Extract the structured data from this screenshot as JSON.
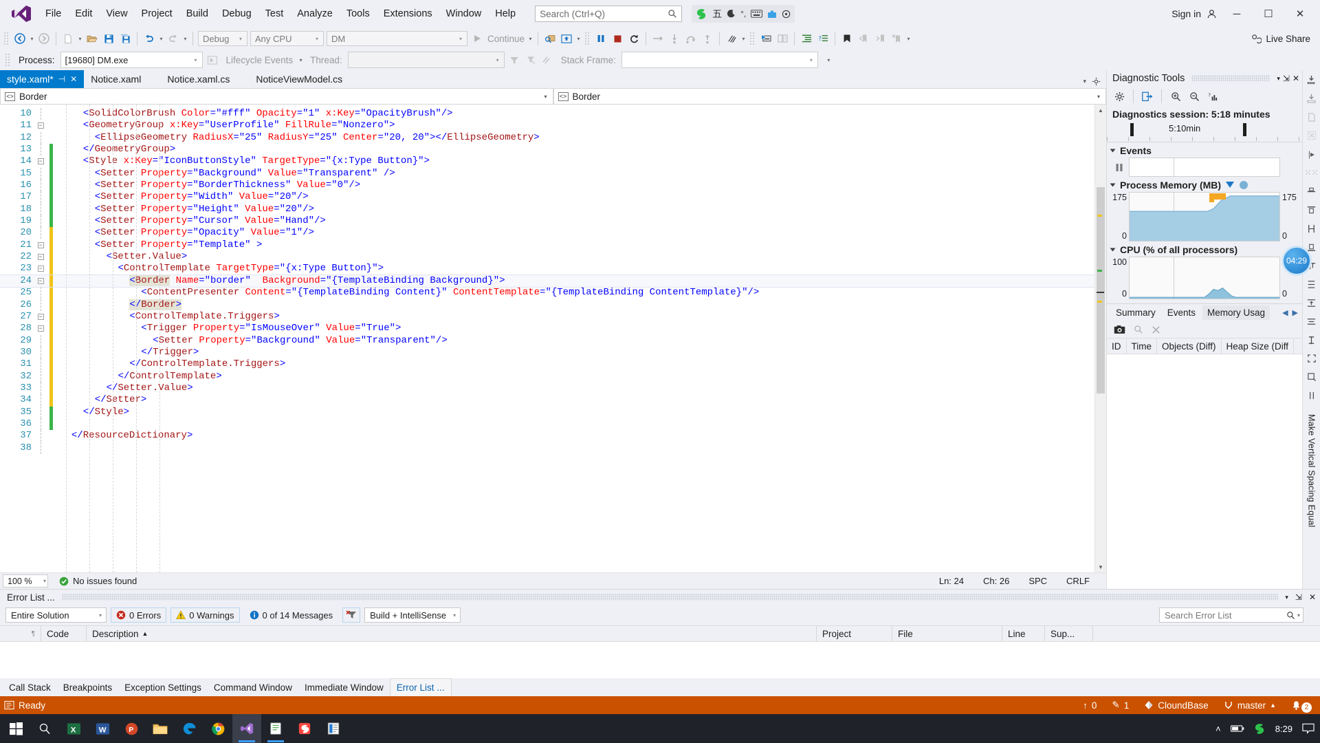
{
  "app": {
    "menu": [
      "File",
      "Edit",
      "View",
      "Project",
      "Build",
      "Debug",
      "Test",
      "Analyze",
      "Tools",
      "Extensions",
      "Window",
      "Help"
    ],
    "search_placeholder": "Search (Ctrl+Q)",
    "sign_in": "Sign in",
    "live_share": "Live Share",
    "window_buttons": {
      "minimize": "─",
      "maximize": "☐",
      "close": "✕"
    }
  },
  "toolbar": {
    "config_combo": "Debug",
    "platform_combo": "Any CPU",
    "startup_combo": "DM",
    "continue_label": "Continue",
    "icons": [
      "navigate-back-icon",
      "navigate-forward-icon",
      "new-item-icon",
      "open-file-icon",
      "save-icon",
      "save-all-icon",
      "undo-icon",
      "redo-icon",
      "start-debug-icon",
      "attach-icon",
      "hot-reload-icon",
      "pause-icon",
      "stop-icon",
      "restart-icon",
      "show-next-statement-icon",
      "step-into-icon",
      "step-over-icon",
      "step-out-icon",
      "intellitrace-icon",
      "select-control-icon",
      "compare-icon",
      "indent-icon",
      "code-map-icon",
      "bookmark-icon",
      "prev-bookmark-icon",
      "next-bookmark-icon",
      "clear-bookmarks-icon"
    ]
  },
  "debugbar": {
    "process_label": "Process:",
    "process_value": "[19680] DM.exe",
    "lifecycle_label": "Lifecycle Events",
    "thread_label": "Thread:",
    "thread_value": "",
    "stackframe_label": "Stack Frame:",
    "stackframe_value": ""
  },
  "tabs": [
    {
      "label": "style.xaml*",
      "active": true,
      "pinned": true,
      "closable": true
    },
    {
      "label": "Notice.xaml",
      "active": false
    },
    {
      "label": "Notice.xaml.cs",
      "active": false
    },
    {
      "label": "NoticeViewModel.cs",
      "active": false
    }
  ],
  "navbars": {
    "left": "Border",
    "right": "Border"
  },
  "editor": {
    "zoom": "100 %",
    "issues": "No issues found",
    "line_indicator": "Ln: 24",
    "char_indicator": "Ch: 26",
    "spaces": "SPC",
    "eol": "CRLF",
    "first_line": 10,
    "lines": [
      {
        "n": 10,
        "indent": 4,
        "fold": "",
        "bar": "none",
        "text": "<SolidColorBrush Color=\"#fff\" Opacity=\"1\" x:Key=\"OpacityBrush\"/>"
      },
      {
        "n": 11,
        "indent": 4,
        "fold": "-",
        "bar": "none",
        "text": "<GeometryGroup x:Key=\"UserProfile\" FillRule=\"Nonzero\">"
      },
      {
        "n": 12,
        "indent": 6,
        "fold": "",
        "bar": "none",
        "text": "<EllipseGeometry RadiusX=\"25\" RadiusY=\"25\" Center=\"20, 20\"></EllipseGeometry>"
      },
      {
        "n": 13,
        "indent": 4,
        "fold": "",
        "bar": "green",
        "text": "</GeometryGroup>"
      },
      {
        "n": 14,
        "indent": 4,
        "fold": "-",
        "bar": "green",
        "text": "<Style x:Key=\"IconButtonStyle\" TargetType=\"{x:Type Button}\">"
      },
      {
        "n": 15,
        "indent": 6,
        "fold": "",
        "bar": "green",
        "text": "<Setter Property=\"Background\" Value=\"Transparent\" />"
      },
      {
        "n": 16,
        "indent": 6,
        "fold": "",
        "bar": "green",
        "text": "<Setter Property=\"BorderThickness\" Value=\"0\"/>"
      },
      {
        "n": 17,
        "indent": 6,
        "fold": "",
        "bar": "green",
        "text": "<Setter Property=\"Width\" Value=\"20\"/>"
      },
      {
        "n": 18,
        "indent": 6,
        "fold": "",
        "bar": "green",
        "text": "<Setter Property=\"Height\" Value=\"20\"/>"
      },
      {
        "n": 19,
        "indent": 6,
        "fold": "",
        "bar": "green",
        "text": "<Setter Property=\"Cursor\" Value=\"Hand\"/>"
      },
      {
        "n": 20,
        "indent": 6,
        "fold": "",
        "bar": "yellow",
        "text": "<Setter Property=\"Opacity\" Value=\"1\"/>"
      },
      {
        "n": 21,
        "indent": 6,
        "fold": "-",
        "bar": "yellow",
        "text": "<Setter Property=\"Template\" >"
      },
      {
        "n": 22,
        "indent": 8,
        "fold": "-",
        "bar": "yellow",
        "text": "<Setter.Value>"
      },
      {
        "n": 23,
        "indent": 10,
        "fold": "-",
        "bar": "yellow",
        "text": "<ControlTemplate TargetType=\"{x:Type Button}\">"
      },
      {
        "n": 24,
        "indent": 12,
        "fold": "-",
        "bar": "yellow",
        "text": "<Border Name=\"border\"  Background=\"{TemplateBinding Background}\">",
        "current": true
      },
      {
        "n": 25,
        "indent": 14,
        "fold": "",
        "bar": "yellow",
        "text": "<ContentPresenter Content=\"{TemplateBinding Content}\" ContentTemplate=\"{TemplateBinding ContentTemplate}\"/>"
      },
      {
        "n": 26,
        "indent": 12,
        "fold": "",
        "bar": "yellow",
        "text": "</Border>",
        "matchtag": true
      },
      {
        "n": 27,
        "indent": 12,
        "fold": "-",
        "bar": "yellow",
        "text": "<ControlTemplate.Triggers>"
      },
      {
        "n": 28,
        "indent": 14,
        "fold": "-",
        "bar": "yellow",
        "text": "<Trigger Property=\"IsMouseOver\" Value=\"True\">"
      },
      {
        "n": 29,
        "indent": 16,
        "fold": "",
        "bar": "yellow",
        "text": "<Setter Property=\"Background\" Value=\"Transparent\"/>"
      },
      {
        "n": 30,
        "indent": 14,
        "fold": "",
        "bar": "yellow",
        "text": "</Trigger>"
      },
      {
        "n": 31,
        "indent": 12,
        "fold": "",
        "bar": "yellow",
        "text": "</ControlTemplate.Triggers>"
      },
      {
        "n": 32,
        "indent": 10,
        "fold": "",
        "bar": "yellow",
        "text": "</ControlTemplate>"
      },
      {
        "n": 33,
        "indent": 8,
        "fold": "",
        "bar": "yellow",
        "text": "</Setter.Value>"
      },
      {
        "n": 34,
        "indent": 6,
        "fold": "",
        "bar": "yellow",
        "text": "</Setter>"
      },
      {
        "n": 35,
        "indent": 4,
        "fold": "",
        "bar": "green",
        "text": "</Style>"
      },
      {
        "n": 36,
        "indent": 0,
        "fold": "",
        "bar": "green",
        "text": ""
      },
      {
        "n": 37,
        "indent": 2,
        "fold": "",
        "bar": "none",
        "text": "</ResourceDictionary>"
      },
      {
        "n": 38,
        "indent": 0,
        "fold": "",
        "bar": "none",
        "text": ""
      }
    ]
  },
  "diagnostics": {
    "title": "Diagnostic Tools",
    "toolbar_icons": [
      "settings-gear-icon",
      "export-icon",
      "zoom-in-icon",
      "zoom-out-icon",
      "reset-view-icon"
    ],
    "session": "Diagnostics session: 5:18 minutes",
    "ruler_label": "5:10min",
    "sections": {
      "events": "Events",
      "memory": "Process Memory (MB)",
      "cpu": "CPU (% of all processors)"
    },
    "memory_axis": {
      "max_left": "175",
      "max_right": "175",
      "min_left": "0",
      "min_right": "0"
    },
    "cpu_axis": {
      "max_left": "100",
      "max_right": "100",
      "min_left": "0",
      "min_right": "0"
    },
    "tabs": [
      "Summary",
      "Events",
      "Memory Usag"
    ],
    "active_tab": "Memory Usag",
    "tooltip_time": "04:29",
    "columns": [
      "ID",
      "Time",
      "Objects (Diff)",
      "Heap Size (Diff"
    ],
    "tool_icons": [
      "camera-icon",
      "search-icon",
      "clear-icon"
    ]
  },
  "chart_data": [
    {
      "type": "area",
      "title": "Process Memory (MB)",
      "xlabel": "",
      "ylabel": "MB",
      "ylim": [
        0,
        175
      ],
      "grid": false,
      "x": [
        0,
        10,
        20,
        30,
        40,
        50,
        55,
        60,
        65,
        70,
        75,
        80,
        85,
        90,
        95,
        100
      ],
      "values": [
        108,
        108,
        108,
        108,
        108,
        108,
        110,
        118,
        140,
        160,
        162,
        162,
        162,
        162,
        162,
        162
      ],
      "annotation": "orange memory-allocation marker near x=70"
    },
    {
      "type": "area",
      "title": "CPU (% of all processors)",
      "xlabel": "",
      "ylabel": "%",
      "ylim": [
        0,
        100
      ],
      "grid": false,
      "x": [
        0,
        10,
        20,
        30,
        40,
        50,
        55,
        60,
        65,
        70,
        75,
        80,
        85,
        90,
        95,
        100
      ],
      "values": [
        0,
        0,
        0,
        0,
        0,
        0,
        2,
        10,
        13,
        11,
        14,
        12,
        5,
        1,
        0,
        0
      ]
    }
  ],
  "errorlist": {
    "title": "Error List ...",
    "scope": "Entire Solution",
    "errors": "0 Errors",
    "warnings": "0 Warnings",
    "messages": "0 of 14 Messages",
    "filter_icon": "clear-filter-icon",
    "build_filter": "Build + IntelliSense",
    "search_placeholder": "Search Error List",
    "columns": [
      "",
      "Code",
      "Description",
      "Project",
      "File",
      "Line",
      "Sup..."
    ],
    "sort_column": "Description",
    "rows": []
  },
  "dock_tabs": {
    "items": [
      "Call Stack",
      "Breakpoints",
      "Exception Settings",
      "Command Window",
      "Immediate Window",
      "Error List ..."
    ],
    "active": "Error List ..."
  },
  "statusbar": {
    "state": "Ready",
    "outgoing": "0",
    "changes": "1",
    "repo": "CloundBase",
    "branch": "master",
    "notifications": "2"
  },
  "taskbar": {
    "apps": [
      "start-icon",
      "search-icon",
      "excel-icon",
      "word-icon",
      "powerpoint-icon",
      "file-explorer-icon",
      "edge-icon",
      "chrome-icon",
      "visual-studio-icon",
      "notepad-icon",
      "sogou-icon",
      "reader-icon"
    ],
    "clock": "8:29",
    "tray": [
      "show-hidden-icon",
      "battery-icon",
      "sogou-ime-icon",
      "notifications-icon"
    ]
  },
  "colors": {
    "accent": "#007acc",
    "status": "#ca5100",
    "tag": "#a31515",
    "attr": "#ff0000",
    "value": "#0000ff",
    "linenum": "#2b91af"
  }
}
